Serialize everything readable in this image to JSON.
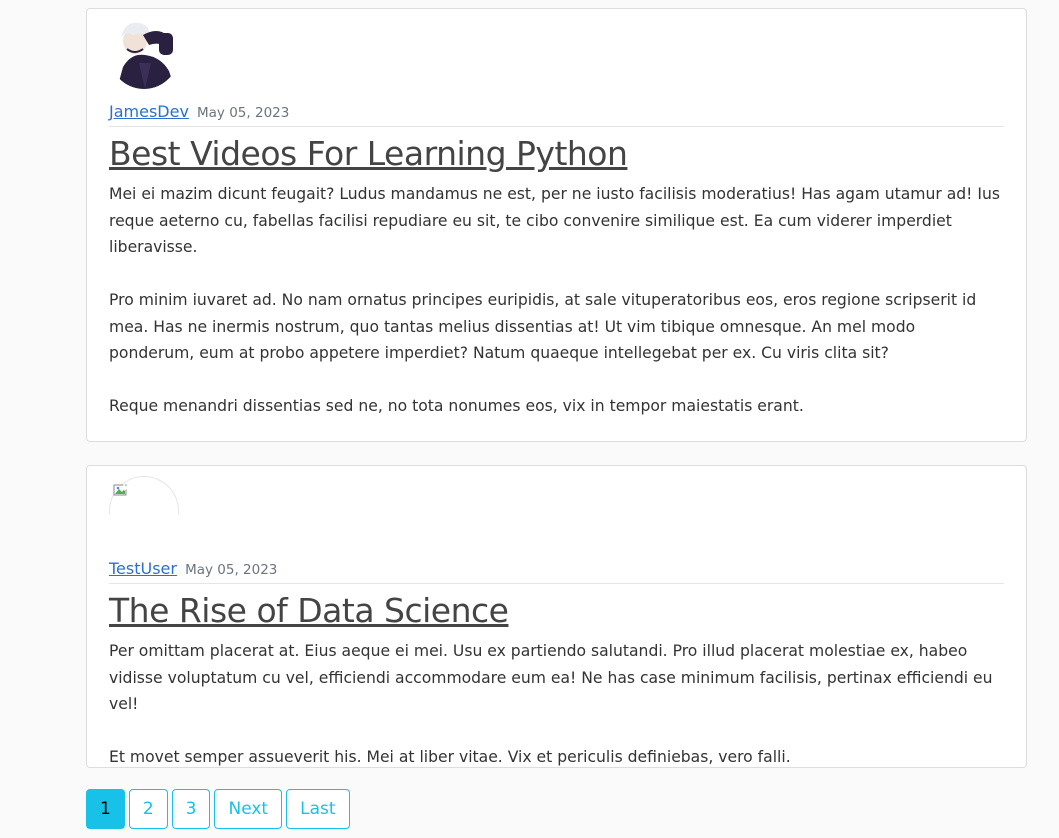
{
  "posts": [
    {
      "author": "JamesDev",
      "date": "May 05, 2023",
      "title": "Best Videos For Learning Python",
      "body": "Mei ei mazim dicunt feugait? Ludus mandamus ne est, per ne iusto facilisis moderatius! Has agam utamur ad! Ius reque aeterno cu, fabellas facilisi repudiare eu sit, te cibo convenire similique est. Ea cum viderer imperdiet liberavisse.\n\nPro minim iuvaret ad. No nam ornatus principes euripidis, at sale vituperatoribus eos, eros regione scripserit id mea. Has ne inermis nostrum, quo tantas melius dissentias at! Ut vim tibique omnesque. An mel modo ponderum, eum at probo appetere imperdiet? Natum quaeque intellegebat per ex. Cu viris clita sit?\n\nReque menandri dissentias sed ne, no tota nonumes eos, vix in tempor maiestatis erant."
    },
    {
      "author": "TestUser",
      "date": "May 05, 2023",
      "title": "The Rise of Data Science",
      "body": "Per omittam placerat at. Eius aeque ei mei. Usu ex partiendo salutandi. Pro illud placerat molestiae ex, habeo vidisse voluptatum cu vel, efficiendi accommodare eum ea! Ne has case minimum facilisis, pertinax efficiendi eu vel!\n\nEt movet semper assueverit his. Mei at liber vitae. Vix et periculis definiebas, vero falli."
    }
  ],
  "pagination": {
    "pages": [
      "1",
      "2",
      "3"
    ],
    "active_page": "1",
    "next_label": "Next",
    "last_label": "Last"
  },
  "colors": {
    "accent": "#17c1e8",
    "link": "#2c6fd1"
  }
}
